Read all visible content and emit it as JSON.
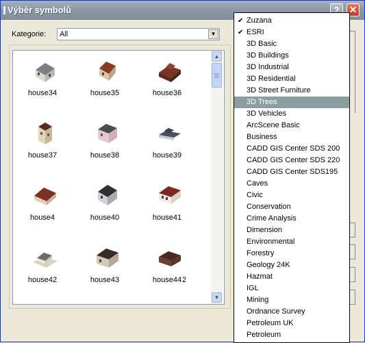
{
  "window": {
    "title": "Výběr symbolů",
    "help_label": "?",
    "close_label": "✕"
  },
  "category": {
    "label": "Kategorie:",
    "value": "All"
  },
  "symbols": [
    {
      "label": "house34"
    },
    {
      "label": "house35"
    },
    {
      "label": "house36"
    },
    {
      "label": "house37"
    },
    {
      "label": "house38"
    },
    {
      "label": "house39"
    },
    {
      "label": "house4"
    },
    {
      "label": "house40"
    },
    {
      "label": "house41"
    },
    {
      "label": "house42"
    },
    {
      "label": "house43"
    },
    {
      "label": "house44"
    }
  ],
  "stray_text": "2",
  "dropdown": {
    "items": [
      {
        "label": "Zuzana",
        "checked": true
      },
      {
        "label": "ESRI",
        "checked": true
      },
      {
        "label": "3D Basic"
      },
      {
        "label": "3D Buildings"
      },
      {
        "label": "3D Industrial"
      },
      {
        "label": "3D Residential"
      },
      {
        "label": "3D Street Furniture"
      },
      {
        "label": "3D Trees",
        "selected": true
      },
      {
        "label": "3D Vehicles"
      },
      {
        "label": "ArcScene Basic"
      },
      {
        "label": "Business"
      },
      {
        "label": "CADD GIS Center SDS 200"
      },
      {
        "label": "CADD GIS Center SDS 220"
      },
      {
        "label": "CADD GIS Center SDS195"
      },
      {
        "label": "Caves"
      },
      {
        "label": "Civic"
      },
      {
        "label": "Conservation"
      },
      {
        "label": "Crime Analysis"
      },
      {
        "label": "Dimension"
      },
      {
        "label": "Environmental"
      },
      {
        "label": "Forestry"
      },
      {
        "label": "Geology 24K"
      },
      {
        "label": "Hazmat"
      },
      {
        "label": "IGL"
      },
      {
        "label": "Mining"
      },
      {
        "label": "Ordnance Survey"
      },
      {
        "label": "Petroleum UK"
      },
      {
        "label": "Petroleum"
      }
    ],
    "check_glyph": "✔"
  },
  "scroll_glyphs": {
    "up": "▲",
    "down": "▼"
  },
  "colors": {
    "titlebar": "#8e9aa8",
    "selection": "#8b9fa3",
    "close": "#c2391c"
  }
}
